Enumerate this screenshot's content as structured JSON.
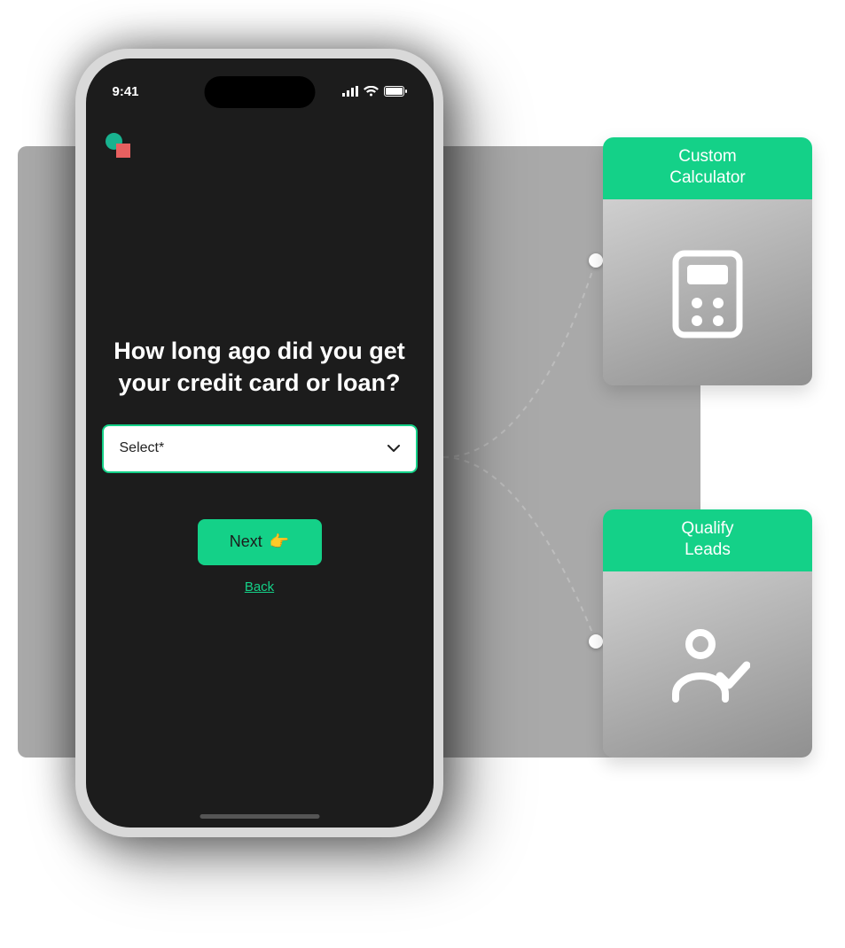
{
  "status": {
    "time": "9:41"
  },
  "form": {
    "question": "How long ago did you get your credit card or loan?",
    "select_placeholder": "Select*",
    "next_label": "Next",
    "back_label": "Back"
  },
  "cards": {
    "top": {
      "line1": "Custom",
      "line2": "Calculator"
    },
    "bottom": {
      "line1": "Qualify",
      "line2": "Leads"
    }
  }
}
